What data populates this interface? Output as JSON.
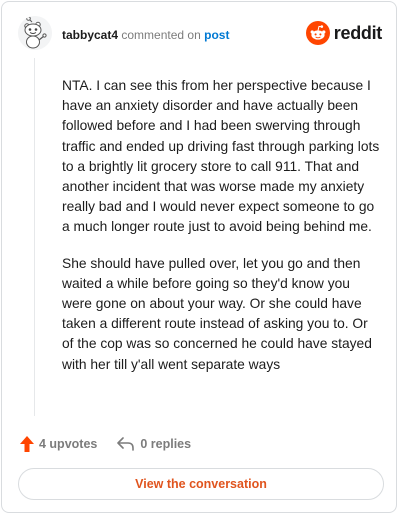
{
  "comment": {
    "username": "tabbycat4",
    "action_text": "commented on",
    "post_link": "post",
    "avatar_icon": "snoo-avatar-icon",
    "paragraphs": [
      "NTA. I can see this from her perspective because I have an anxiety disorder and have actually been followed before and I had been swerving through traffic and ended up driving fast through parking lots to a brightly lit grocery store to call 911. That and another incident that was worse made my anxiety really bad and I would never expect someone to go a much longer route just to avoid being behind me.",
      "She should have pulled over, let you go and then waited a while before going so they'd know you were gone on about your way. Or she could have taken a different route instead of asking you to. Or of the cop was so concerned he could have stayed with her till y'all went separate ways"
    ]
  },
  "brand": {
    "name": "reddit",
    "logo_icon": "reddit-logo-icon",
    "color": "#ff4500"
  },
  "footer": {
    "upvotes_label": "4 upvotes",
    "upvote_icon": "upvote-arrow-icon",
    "upvote_color": "#ff4500",
    "replies_label": "0 replies",
    "reply_icon": "reply-arrow-icon"
  },
  "cta": {
    "label": "View the conversation",
    "color": "#e0541e"
  }
}
